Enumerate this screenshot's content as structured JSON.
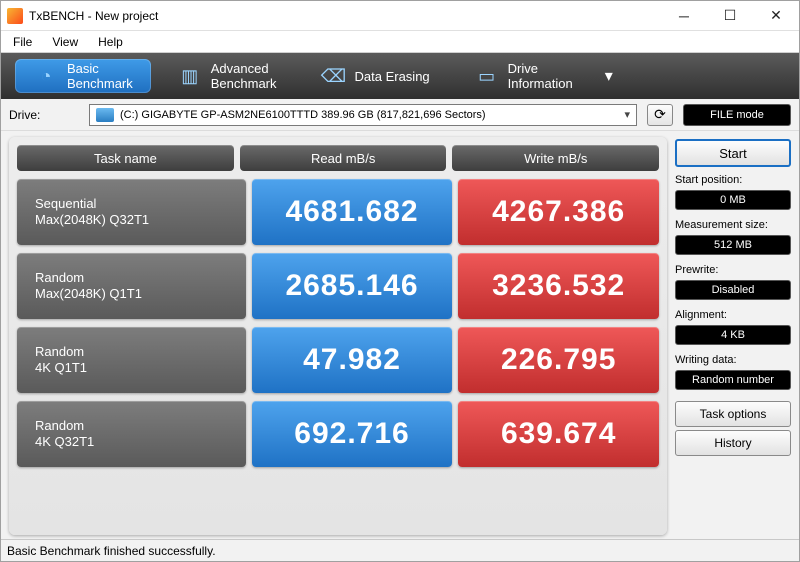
{
  "window": {
    "title": "TxBENCH - New project"
  },
  "menu": {
    "file": "File",
    "view": "View",
    "help": "Help"
  },
  "toolbar": {
    "basic_line1": "Basic",
    "basic_line2": "Benchmark",
    "advanced_line1": "Advanced",
    "advanced_line2": "Benchmark",
    "erasing": "Data Erasing",
    "drive_line1": "Drive",
    "drive_line2": "Information"
  },
  "drive": {
    "label": "Drive:",
    "selected": "(C:) GIGABYTE GP-ASM2NE6100TTTD  389.96 GB (817,821,696 Sectors)",
    "filemode": "FILE mode"
  },
  "headers": {
    "task": "Task name",
    "read": "Read mB/s",
    "write": "Write mB/s"
  },
  "rows": [
    {
      "name_l1": "Sequential",
      "name_l2": "Max(2048K) Q32T1",
      "read": "4681.682",
      "write": "4267.386"
    },
    {
      "name_l1": "Random",
      "name_l2": "Max(2048K) Q1T1",
      "read": "2685.146",
      "write": "3236.532"
    },
    {
      "name_l1": "Random",
      "name_l2": "4K Q1T1",
      "read": "47.982",
      "write": "226.795"
    },
    {
      "name_l1": "Random",
      "name_l2": "4K Q32T1",
      "read": "692.716",
      "write": "639.674"
    }
  ],
  "side": {
    "start": "Start",
    "startpos_label": "Start position:",
    "startpos_val": "0 MB",
    "measure_label": "Measurement size:",
    "measure_val": "512 MB",
    "prewrite_label": "Prewrite:",
    "prewrite_val": "Disabled",
    "align_label": "Alignment:",
    "align_val": "4 KB",
    "writedata_label": "Writing data:",
    "writedata_val": "Random number",
    "taskoptions": "Task options",
    "history": "History"
  },
  "status": "Basic Benchmark finished successfully."
}
